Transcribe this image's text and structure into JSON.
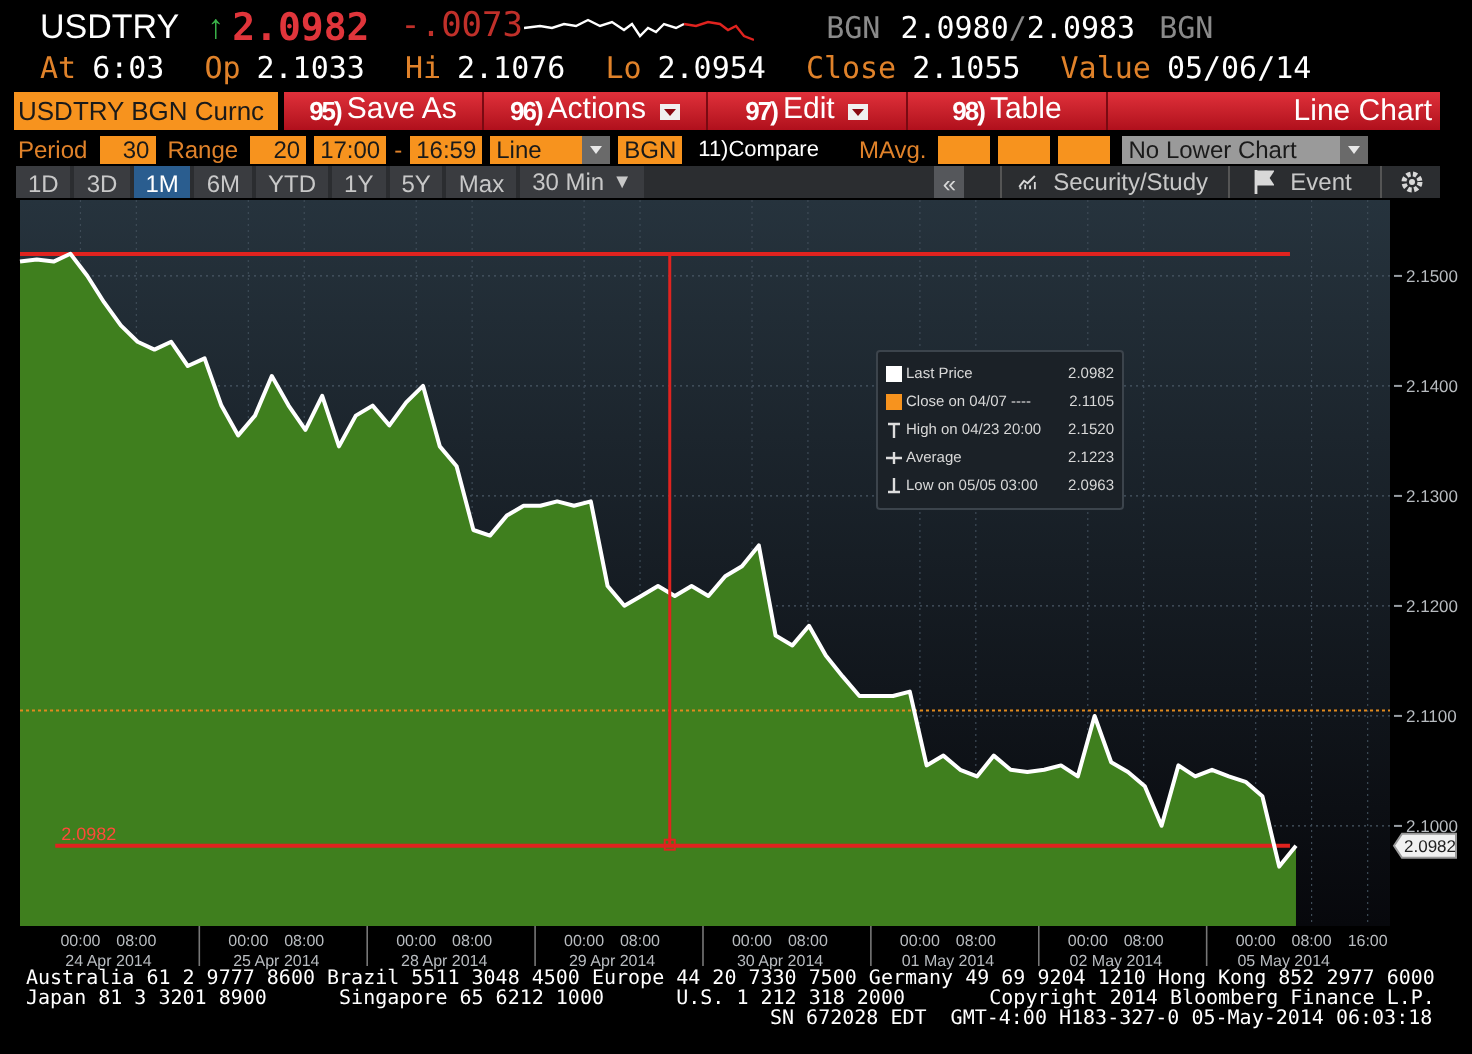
{
  "quote": {
    "ticker": "USDTRY",
    "arrow": "↑",
    "last": "2.0982",
    "change": "-.0073",
    "bid_source": "BGN",
    "bid": "2.0980",
    "separator": "/",
    "ask": "2.0983",
    "ask_source": "BGN"
  },
  "stats": [
    {
      "label": "At",
      "value": "6:03"
    },
    {
      "label": "Op",
      "value": "2.1033"
    },
    {
      "label": "Hi",
      "value": "2.1076"
    },
    {
      "label": "Lo",
      "value": "2.0954"
    },
    {
      "label": "Close",
      "value": "2.1055"
    },
    {
      "label": "Value",
      "value": "05/06/14"
    }
  ],
  "security": "USDTRY BGN Curnc",
  "actions": [
    {
      "number": "95)",
      "label": "Save As",
      "dropdown": false
    },
    {
      "number": "96)",
      "label": "Actions",
      "dropdown": true
    },
    {
      "number": "97)",
      "label": "Edit",
      "dropdown": true
    },
    {
      "number": "98)",
      "label": "Table",
      "dropdown": false
    }
  ],
  "chart_title": "Line Chart",
  "settings": [
    {
      "kind": "label",
      "text": "Period"
    },
    {
      "kind": "input",
      "text": "30"
    },
    {
      "kind": "label",
      "text": "Range"
    },
    {
      "kind": "input",
      "text": "20"
    },
    {
      "kind": "input",
      "text": "17:00"
    },
    {
      "kind": "dash",
      "text": "-"
    },
    {
      "kind": "input",
      "text": "16:59"
    },
    {
      "kind": "select",
      "text": "Line"
    },
    {
      "kind": "input",
      "text": "BGN"
    },
    {
      "kind": "command",
      "text": "11)Compare"
    },
    {
      "kind": "label",
      "text": "MAvg."
    },
    {
      "kind": "blank"
    },
    {
      "kind": "blank"
    },
    {
      "kind": "blank"
    },
    {
      "kind": "gray_select",
      "text": "No Lower Chart"
    }
  ],
  "ranges": [
    {
      "label": "1D",
      "selected": false
    },
    {
      "label": "3D",
      "selected": false
    },
    {
      "label": "1M",
      "selected": true
    },
    {
      "label": "6M",
      "selected": false
    },
    {
      "label": "YTD",
      "selected": false
    },
    {
      "label": "1Y",
      "selected": false
    },
    {
      "label": "5Y",
      "selected": false
    },
    {
      "label": "Max",
      "selected": false
    }
  ],
  "interval": {
    "label": "30 Min",
    "caret": "▼"
  },
  "panel_toggle": "«",
  "tools": [
    {
      "kind": "study",
      "label": "Security/Study"
    },
    {
      "kind": "event",
      "label": "Event"
    },
    {
      "kind": "settings"
    }
  ],
  "chart": {
    "chart_data": {
      "type": "area",
      "grid": true,
      "series": [
        {
          "color": "#ffffff",
          "values": [
            2.1513,
            2.1515,
            2.1513,
            2.152,
            2.15,
            2.1476,
            2.1455,
            2.144,
            2.1433,
            2.144,
            2.1418,
            2.1425,
            2.1382,
            2.1355,
            2.1373,
            2.1409,
            2.1382,
            2.136,
            2.1391,
            2.1345,
            2.1373,
            2.1382,
            2.1364,
            2.1385,
            2.14,
            2.1345,
            2.1327,
            2.1269,
            2.1264,
            2.1282,
            2.1291,
            2.1291,
            2.1295,
            2.1291,
            2.1295,
            2.1218,
            2.12,
            2.1209,
            2.1218,
            2.1209,
            2.1218,
            2.1209,
            2.1227,
            2.1236,
            2.1255,
            2.1173,
            2.1164,
            2.1182,
            2.1155,
            2.1136,
            2.1118,
            2.1118,
            2.1118,
            2.1122,
            2.1055,
            2.1064,
            2.1051,
            2.1045,
            2.1064,
            2.1051,
            2.1049,
            2.1051,
            2.1055,
            2.1045,
            2.11,
            2.1058,
            2.1049,
            2.1036,
            2.1,
            2.1055,
            2.1045,
            2.1051,
            2.1045,
            2.104,
            2.1027,
            2.0963,
            2.0982
          ]
        }
      ],
      "ylim": [
        2.0909,
        2.1569
      ],
      "ref_lines": [
        {
          "axis": "y",
          "value": 2.152,
          "color": "#e0231f"
        },
        {
          "axis": "y",
          "value": 2.1105,
          "color": "#e08a1e"
        },
        {
          "axis": "y",
          "value": 2.0982,
          "color": "#e0231f"
        }
      ],
      "yticks": [
        {
          "value": 2.1,
          "label": "2.1000"
        },
        {
          "value": 2.11,
          "label": "2.1100"
        },
        {
          "value": 2.12,
          "label": "2.1200"
        },
        {
          "value": 2.13,
          "label": "2.1300"
        },
        {
          "value": 2.14,
          "label": "2.1400"
        },
        {
          "value": 2.15,
          "label": "2.1500"
        }
      ]
    },
    "time_labels": [
      "00:00",
      "08:00",
      "00:00",
      "08:00",
      "00:00",
      "08:00",
      "00:00",
      "08:00",
      "00:00",
      "08:00",
      "00:00",
      "08:00",
      "00:00",
      "08:00",
      "00:00",
      "08:00",
      "16:00"
    ],
    "date_labels": [
      "24 Apr 2014",
      "25 Apr 2014",
      "28 Apr 2014",
      "29 Apr 2014",
      "30 Apr 2014",
      "01 May 2014",
      "02 May 2014",
      "05 May 2014"
    ],
    "level_label": "2.0982",
    "last_price_tag": "2.0982",
    "legend": [
      {
        "kind": "last",
        "label": "Last Price",
        "value": "2.0982"
      },
      {
        "kind": "close",
        "label": "Close on 04/07 ----",
        "value": "2.1105"
      },
      {
        "kind": "high",
        "label": "High on 04/23 20:00",
        "value": "2.1520"
      },
      {
        "kind": "average",
        "label": "Average",
        "value": "2.1223"
      },
      {
        "kind": "low",
        "label": "Low on 05/05 03:00",
        "value": "2.0963"
      }
    ]
  },
  "footer": [
    "Australia 61 2 9777 8600 Brazil 5511 3048 4500 Europe 44 20 7330 7500 Germany 49 69 9204 1210 Hong Kong 852 2977 6000",
    "Japan 81 3 3201 8900      Singapore 65 6212 1000      U.S. 1 212 318 2000       Copyright 2014 Bloomberg Finance L.P.",
    "SN 672028 EDT  GMT-4:00 H183-327-0 05-May-2014 06:03:18"
  ]
}
